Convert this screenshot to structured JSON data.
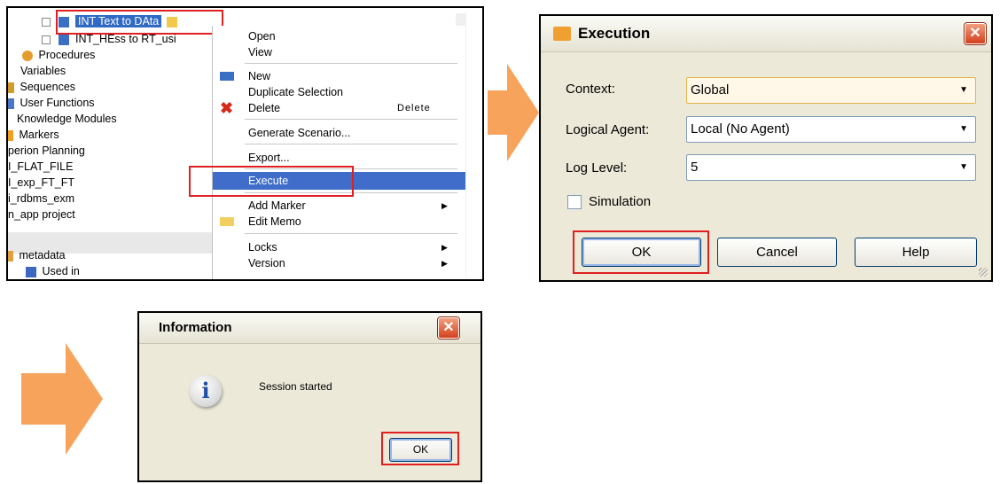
{
  "tree": {
    "items": [
      "INT Text to DAta",
      "INT_HEss to RT_usi",
      "Procedures",
      "Variables",
      "Sequences",
      "User Functions",
      "Knowledge Modules",
      "Markers",
      "perion Planning",
      "I_FLAT_FILE",
      "I_exp_FT_FT",
      "i_rdbms_exm",
      "n_app project",
      "metadata",
      "Used in"
    ]
  },
  "context_menu": {
    "open": "Open",
    "view": "View",
    "new": "New",
    "duplicate_selection": "Duplicate Selection",
    "delete": "Delete",
    "delete_accel": "Delete",
    "generate_scenario": "Generate Scenario...",
    "export": "Export...",
    "execute": "Execute",
    "add_marker": "Add Marker",
    "edit_memo": "Edit Memo",
    "locks": "Locks",
    "version": "Version"
  },
  "execution_dialog": {
    "title": "Execution",
    "context_label": "Context:",
    "context_value": "Global",
    "logical_agent_label": "Logical Agent:",
    "logical_agent_value": "Local (No Agent)",
    "log_level_label": "Log Level:",
    "log_level_value": "5",
    "simulation_label": "Simulation",
    "simulation_checked": false,
    "ok": "OK",
    "cancel": "Cancel",
    "help": "Help"
  },
  "info_dialog": {
    "title": "Information",
    "message": "Session started",
    "ok": "OK"
  },
  "colors": {
    "arrow": "#f7a35c",
    "highlight_box": "#e02020",
    "menu_selection": "#3f6dc9"
  }
}
